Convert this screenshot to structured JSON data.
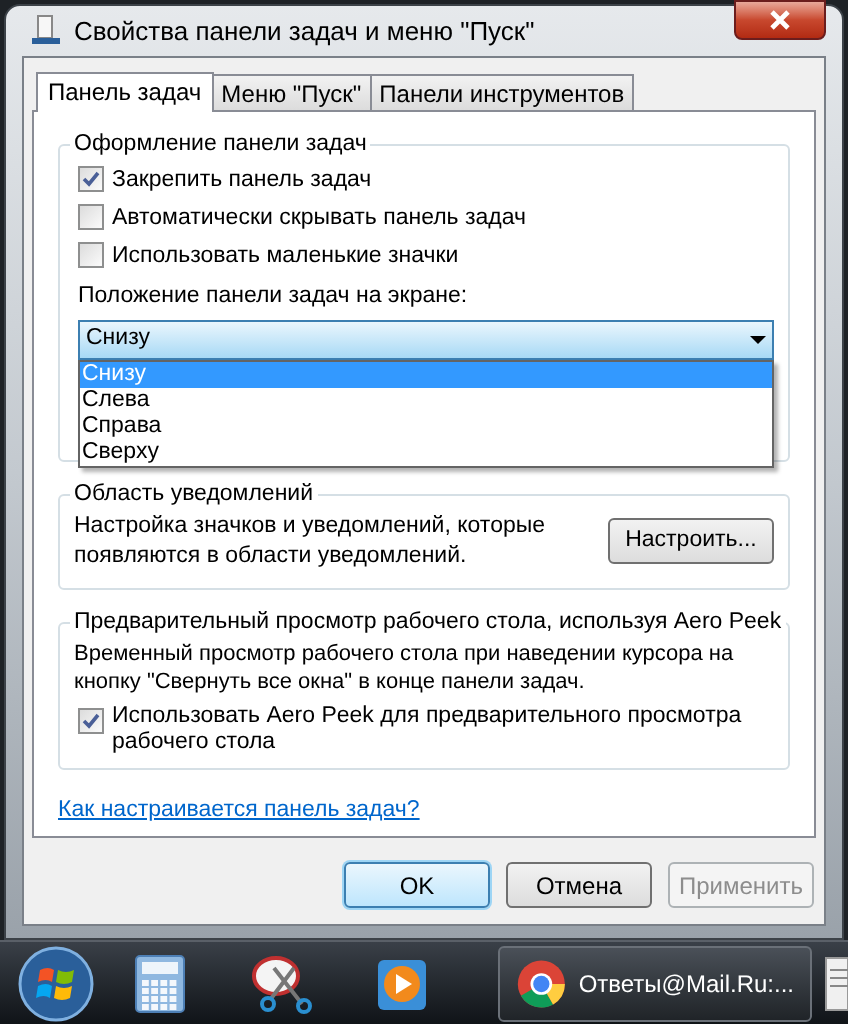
{
  "window": {
    "title": "Свойства панели задач и меню \"Пуск\""
  },
  "tabs": [
    {
      "label": "Панель задач",
      "selected": true
    },
    {
      "label": "Меню \"Пуск\"",
      "selected": false
    },
    {
      "label": "Панели инструментов",
      "selected": false
    }
  ],
  "appearance": {
    "title": "Оформление панели задач",
    "options": [
      {
        "label": "Закрепить панель задач",
        "checked": true
      },
      {
        "label": "Автоматически скрывать панель задач",
        "checked": false
      },
      {
        "label": "Использовать маленькие значки",
        "checked": false
      }
    ],
    "position_label": "Положение панели задач на экране:",
    "position_select": {
      "value": "Снизу",
      "expanded": true,
      "options": [
        {
          "label": "Снизу",
          "selected": true
        },
        {
          "label": "Слева",
          "selected": false
        },
        {
          "label": "Справа",
          "selected": false
        },
        {
          "label": "Сверху",
          "selected": false
        }
      ]
    }
  },
  "notifications": {
    "title": "Область уведомлений",
    "description": "Настройка значков и уведомлений, которые появляются в области уведомлений.",
    "button": "Настроить..."
  },
  "aero_peek": {
    "title": "Предварительный просмотр рабочего стола, используя Aero Peek",
    "description": "Временный просмотр рабочего стола при наведении курсора на кнопку \"Свернуть все окна\" в конце панели задач.",
    "option": {
      "label": "Использовать Aero Peek для предварительного просмотра рабочего стола",
      "checked": true
    }
  },
  "help_link": "Как настраивается панель задач?",
  "buttons": [
    {
      "label": "OK",
      "default": true,
      "disabled": false
    },
    {
      "label": "Отмена",
      "default": false,
      "disabled": false
    },
    {
      "label": "Применить",
      "default": false,
      "disabled": true
    }
  ],
  "taskbar": {
    "items": [
      {
        "kind": "start"
      },
      {
        "kind": "calculator"
      },
      {
        "kind": "scissors"
      },
      {
        "kind": "media"
      },
      {
        "kind": "browser",
        "label": "Ответы@Mail.Ru:..."
      },
      {
        "kind": "document"
      }
    ]
  }
}
